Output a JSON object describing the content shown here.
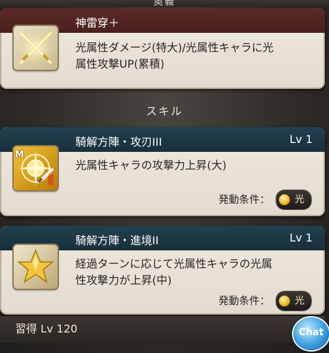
{
  "top_section": {
    "label": "奥義"
  },
  "ougi": {
    "name": "神雷穿＋",
    "description_line1": "光属性ダメージ(特大)/光属性キャラに光",
    "description_line2": "属性攻撃UP(累積)",
    "icon": "crossed-swords-icon"
  },
  "skills_section": {
    "label": "スキル"
  },
  "skills": [
    {
      "name": "騎解方陣・攻刃III",
      "level": "Lv 1",
      "description_line1": "光属性キャラの攻撃力上昇(大)",
      "description_line2": "",
      "condition_label": "発動条件：",
      "condition_value": "光",
      "icon": "compass-sword-icon",
      "icon_badge": "M"
    },
    {
      "name": "騎解方陣・進境II",
      "level": "Lv 1",
      "description_line1": "経過ターンに応じて光属性キャラの光属",
      "description_line2": "性攻撃力が上昇(中)",
      "condition_label": "発動条件：",
      "condition_value": "光",
      "icon": "star-icon"
    }
  ],
  "learn": {
    "label": "習得 Lv 120"
  },
  "chat_button": {
    "label": "Chat"
  },
  "colors": {
    "ougi_header": "#4a1f1d",
    "skill_header": "#17303c",
    "card_bg": "#e8e1d5",
    "light_element": "#e8b21a"
  }
}
